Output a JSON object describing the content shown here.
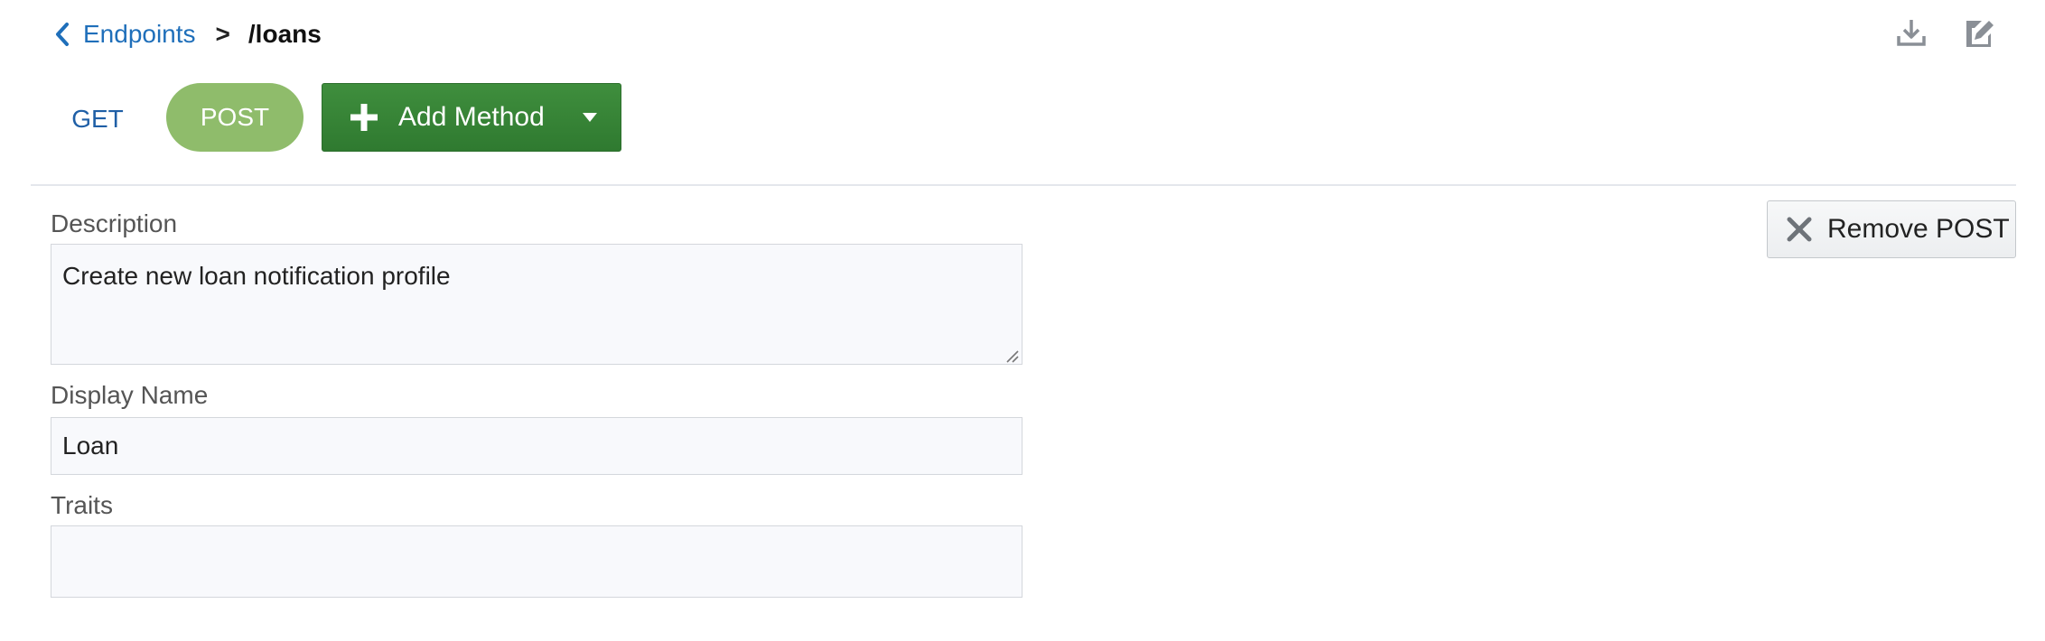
{
  "breadcrumb": {
    "back_label": "Endpoints",
    "separator": ">",
    "current": "/loans"
  },
  "toolbar": {
    "icons": [
      "download-icon",
      "edit-icon"
    ]
  },
  "methods": {
    "tabs": [
      {
        "label": "GET",
        "selected": false
      },
      {
        "label": "POST",
        "selected": true
      }
    ],
    "add_method_label": "Add Method"
  },
  "form": {
    "description_label": "Description",
    "description_value": "Create new loan notification profile",
    "display_name_label": "Display Name",
    "display_name_value": "Loan",
    "traits_label": "Traits",
    "traits_value": ""
  },
  "actions": {
    "remove_label": "Remove POST"
  },
  "colors": {
    "link": "#1f6fba",
    "post_tab": "#8fbc6b",
    "add_button": "#3a873a",
    "field_bg": "#f8f9fc"
  }
}
